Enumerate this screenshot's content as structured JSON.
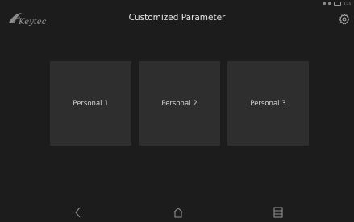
{
  "app": {
    "logo_text": "Keytec",
    "title": "Customized Parameter"
  },
  "status_bar": {
    "time": "1:35"
  },
  "tiles": [
    {
      "label": "Personal 1"
    },
    {
      "label": "Personal 2"
    },
    {
      "label": "Personal 3"
    }
  ],
  "icons": {
    "settings": "gear-icon",
    "back": "chevron-left-icon",
    "home": "home-icon",
    "recent": "recent-apps-icon"
  },
  "colors": {
    "background": "#1c1c1c",
    "tile": "#2e2e2e",
    "text": "#d6d6d6"
  }
}
